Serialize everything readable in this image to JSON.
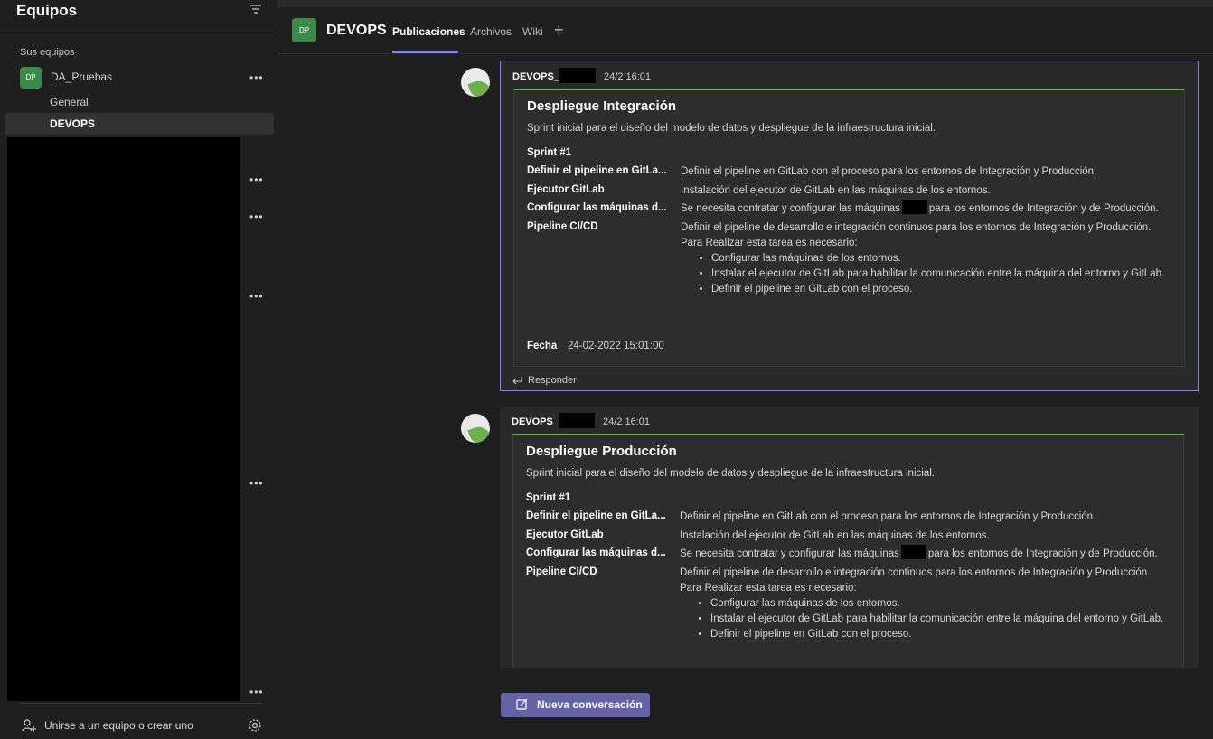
{
  "sidebar": {
    "title": "Equipos",
    "section_label": "Sus equipos",
    "team": {
      "avatar": "DP",
      "name": "DA_Pruebas"
    },
    "channels": [
      "General",
      "DEVOPS"
    ],
    "join_label": "Unirse a un equipo o crear uno"
  },
  "channel": {
    "avatar": "DP",
    "name": "DEVOPS",
    "tabs": [
      "Publicaciones",
      "Archivos",
      "Wiki"
    ],
    "add_tab": "+"
  },
  "posts": [
    {
      "author": "DEVOPS_",
      "time": "24/2 16:01",
      "card": {
        "title": "Despliegue Integración",
        "description": "Sprint inicial para el diseño del modelo de datos y despliegue de la infraestructura inicial.",
        "sprint": "Sprint #1",
        "facts": [
          {
            "key": "Definir el pipeline en GitLa...",
            "value": "Definir el pipeline en GitLab con el proceso para los entornos de Integración y Producción."
          },
          {
            "key": "Ejecutor GitLab",
            "value": "Instalación del ejecutor de GitLab en las máquinas de los entornos."
          },
          {
            "key": "Configurar las máquinas d...",
            "value_before": "Se necesita contratar y configurar las máquinas",
            "value_after": "para los entornos de Integración y de Producción."
          },
          {
            "key": "Pipeline CI/CD",
            "value": "Definir el pipeline de desarrollo e integración continuos para los entornos de Integración y Producción.",
            "intro": "Para Realizar esta tarea es necesario:",
            "bullets": [
              "Configurar las máquinas de los entornos.",
              "Instalar el ejecutor de GitLab para habilitar la comunicación entre la máquina del entorno y GitLab.",
              "Definir el pipeline en GitLab con el proceso."
            ]
          }
        ],
        "fecha_label": "Fecha",
        "fecha_value": "24-02-2022 15:01:00"
      },
      "reply_label": "Responder"
    },
    {
      "author": "DEVOPS_",
      "time": "24/2 16:01",
      "card": {
        "title": "Despliegue Producción",
        "description": "Sprint inicial para el diseño del modelo de datos y despliegue de la infraestructura inicial.",
        "sprint": "Sprint #1",
        "facts": [
          {
            "key": "Definir el pipeline en GitLa...",
            "value": "Definir el pipeline en GitLab con el proceso para los entornos de Integración y Producción."
          },
          {
            "key": "Ejecutor GitLab",
            "value": "Instalación del ejecutor de GitLab en las máquinas de los entornos."
          },
          {
            "key": "Configurar las máquinas d...",
            "value_before": "Se necesita contratar y configurar las máquinas",
            "value_after": "para los entornos de Integración y de Producción."
          },
          {
            "key": "Pipeline CI/CD",
            "value": "Definir el pipeline de desarrollo e integración continuos para los entornos de Integración y Producción.",
            "intro": "Para Realizar esta tarea es necesario:",
            "bullets": [
              "Configurar las máquinas de los entornos.",
              "Instalar el ejecutor de GitLab para habilitar la comunicación entre la máquina del entorno y GitLab.",
              "Definir el pipeline en GitLab con el proceso."
            ]
          }
        ]
      }
    }
  ],
  "new_conversation_label": "Nueva conversación",
  "colors": {
    "accent": "#6264a7",
    "tab_underline": "#7f85f5",
    "card_rule": "#6bb24a",
    "team_avatar": "#3a8a4a"
  },
  "icons": [
    "filter-icon",
    "more-options-icon",
    "join-team-icon",
    "settings-icon",
    "reply-icon",
    "compose-icon",
    "add-tab-icon"
  ]
}
